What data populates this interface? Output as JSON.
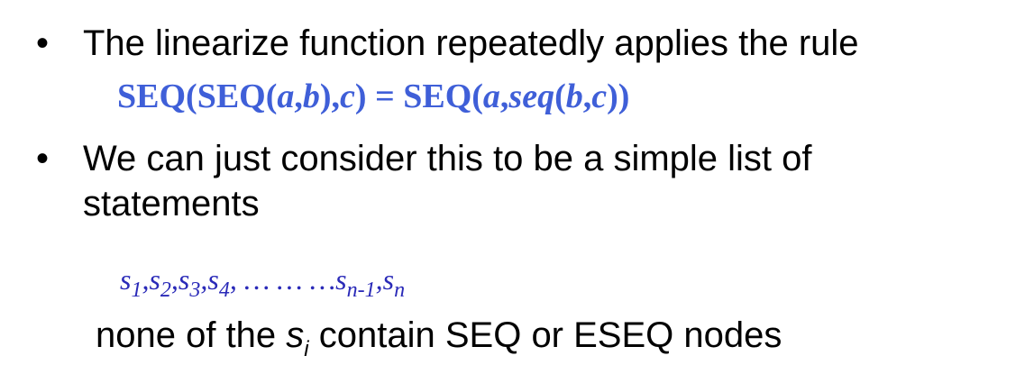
{
  "bullets": [
    {
      "marker": "•",
      "text": "The linearize function repeatedly applies the rule"
    },
    {
      "marker": "•",
      "line1": "We can just consider this to be a simple list of",
      "line2": "statements"
    }
  ],
  "formula": {
    "p1": "SEQ(SEQ(",
    "a": "a",
    "comma1": ",",
    "b": "b",
    "p2": "),",
    "c": "c",
    "p3": ") = SEQ(",
    "a2": "a",
    "comma2": ",",
    "seq": "seq",
    "p4": "(",
    "b2": "b",
    "comma3": ",",
    "c2": "c",
    "p5": "))"
  },
  "sequence": {
    "s": "s",
    "sub1": "1",
    "sub2": "2",
    "sub3": "3",
    "sub4": "4",
    "sep": ",",
    "dots": "… … …",
    "subn1": "n-1",
    "subn": "n"
  },
  "note": {
    "before": "none of the ",
    "s": "s",
    "sub": "i",
    "after": " contain SEQ or ESEQ nodes"
  },
  "colors": {
    "formula": "#3f5fd8",
    "sequence": "#2a2ab8",
    "text": "#000000"
  }
}
